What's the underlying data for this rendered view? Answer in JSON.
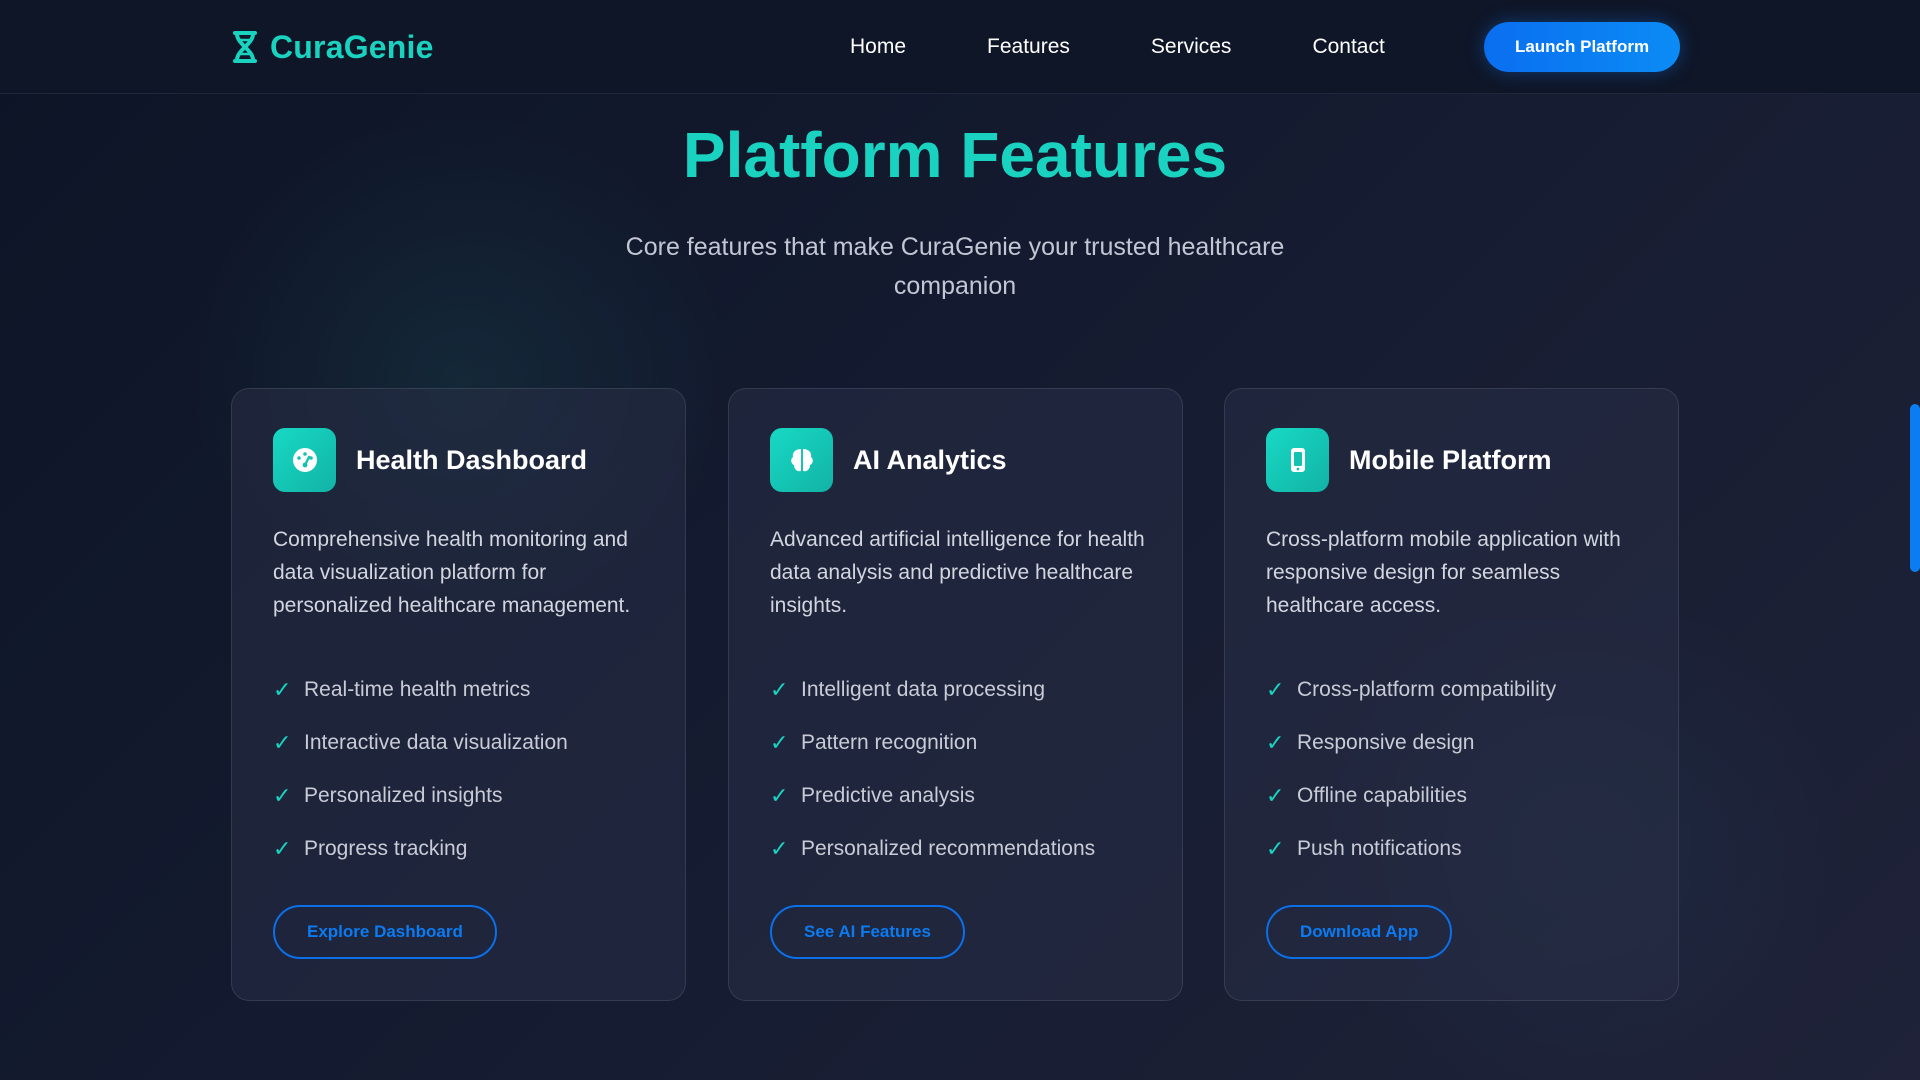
{
  "nav": {
    "brand": "CuraGenie",
    "links": [
      "Home",
      "Features",
      "Services",
      "Contact"
    ],
    "cta": "Launch Platform"
  },
  "header": {
    "title": "Platform Features",
    "subtitle": "Core features that make CuraGenie your trusted healthcare companion"
  },
  "cards": [
    {
      "icon": "gauge-icon",
      "title": "Health Dashboard",
      "description": "Comprehensive health monitoring and data visualization platform for personalized healthcare management.",
      "features": [
        "Real-time health metrics",
        "Interactive data visualization",
        "Personalized insights",
        "Progress tracking"
      ],
      "button": "Explore Dashboard"
    },
    {
      "icon": "brain-icon",
      "title": "AI Analytics",
      "description": "Advanced artificial intelligence for health data analysis and predictive healthcare insights.",
      "features": [
        "Intelligent data processing",
        "Pattern recognition",
        "Predictive analysis",
        "Personalized recommendations"
      ],
      "button": "See AI Features"
    },
    {
      "icon": "mobile-icon",
      "title": "Mobile Platform",
      "description": "Cross-platform mobile application with responsive design for seamless healthcare access.",
      "features": [
        "Cross-platform compatibility",
        "Responsive design",
        "Offline capabilities",
        "Push notifications"
      ],
      "button": "Download App"
    }
  ],
  "check_glyph": "✓",
  "colors": {
    "accent": "#19d3c0",
    "primary_button": "#0a6ef0",
    "background": "#141b30"
  }
}
